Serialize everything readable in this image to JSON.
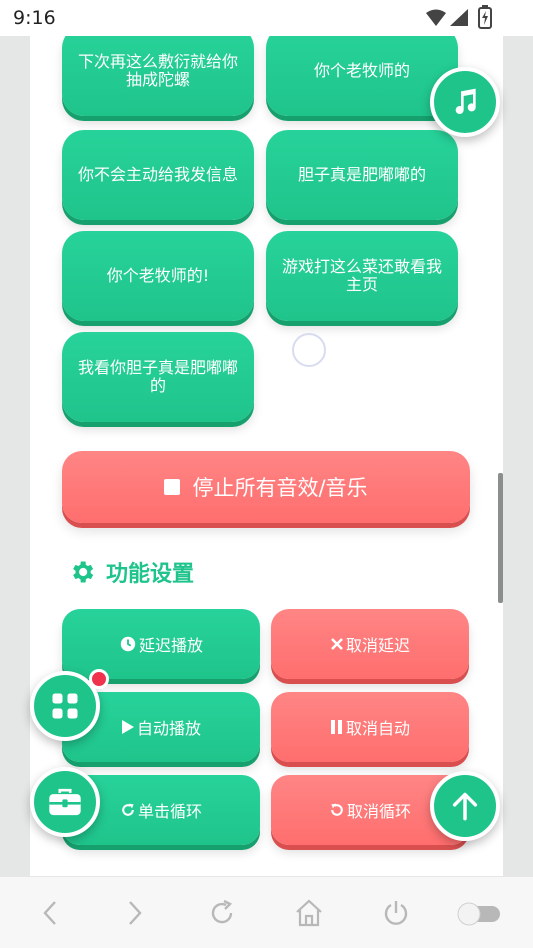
{
  "status_bar": {
    "time": "9:16"
  },
  "sound_buttons": [
    {
      "label": "下次再这么敷衍就给你抽成陀螺"
    },
    {
      "label": "你个老牧师的"
    },
    {
      "label": "你不会主动给我发信息"
    },
    {
      "label": "胆子真是肥嘟嘟的"
    },
    {
      "label": "你个老牧师的!"
    },
    {
      "label": "游戏打这么菜还敢看我主页"
    },
    {
      "label": "我看你胆子真是肥嘟嘟的"
    }
  ],
  "stop_button": {
    "label": "停止所有音效/音乐"
  },
  "settings": {
    "title": "功能设置",
    "buttons": [
      {
        "label": "延迟播放",
        "color": "#1fc48b"
      },
      {
        "label": "取消延迟",
        "color": "#ff6e6e"
      },
      {
        "label": "自动播放",
        "color": "#1fc48b"
      },
      {
        "label": "取消自动",
        "color": "#ff6e6e"
      },
      {
        "label": "单击循环",
        "color": "#1fc48b"
      },
      {
        "label": "取消循环",
        "color": "#ff6e6e"
      }
    ]
  },
  "fabs": {
    "music": "music-note-icon",
    "apps": "grid-icon",
    "tools": "toolbox-icon",
    "top": "arrow-up-icon"
  },
  "colors": {
    "accent": "#1fc48b",
    "danger": "#ff6e6e",
    "badge": "#f0334d"
  }
}
